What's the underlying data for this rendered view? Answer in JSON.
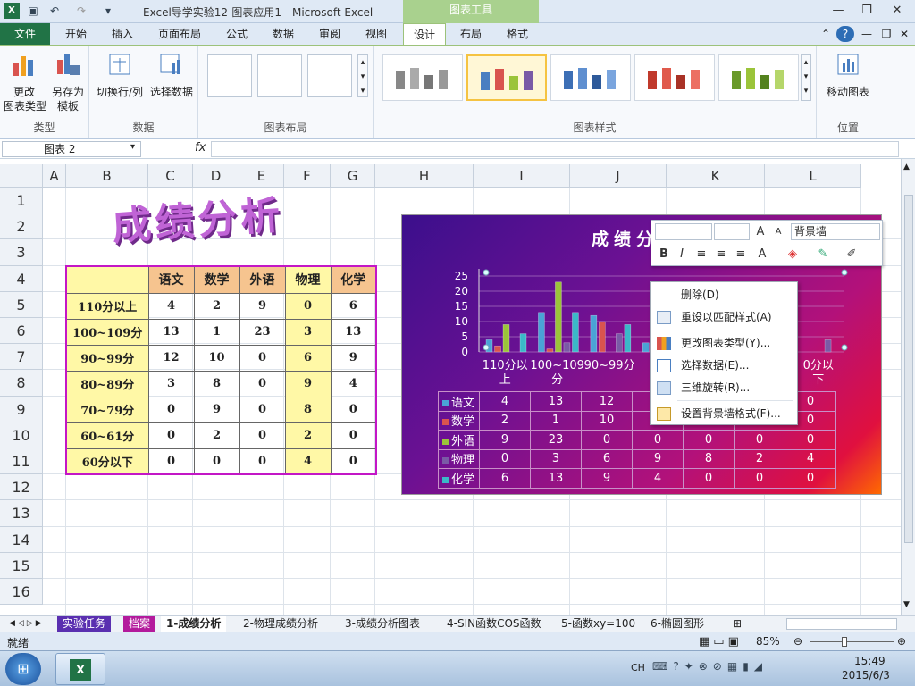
{
  "window": {
    "title": "Excel导学实验12-图表应用1 - Microsoft Excel",
    "context_tools": "图表工具"
  },
  "tabs": [
    "文件",
    "开始",
    "插入",
    "页面布局",
    "公式",
    "数据",
    "审阅",
    "视图",
    "设计",
    "布局",
    "格式"
  ],
  "ribbon": {
    "change_type": "更改\n图表类型",
    "save_template": "另存为\n模板",
    "switch_rowcol": "切换行/列",
    "select_data": "选择数据",
    "move_chart": "移动图表",
    "groups": {
      "type": "类型",
      "data": "数据",
      "layout": "图表布局",
      "styles": "图表样式",
      "location": "位置"
    }
  },
  "formula_bar": {
    "name_box": "图表 2",
    "fx": "fx"
  },
  "columns": [
    "A",
    "B",
    "C",
    "D",
    "E",
    "F",
    "G",
    "H",
    "I",
    "J",
    "K",
    "L"
  ],
  "rows": [
    "1",
    "2",
    "3",
    "4",
    "5",
    "6",
    "7",
    "8",
    "9",
    "10",
    "11",
    "12",
    "13",
    "14",
    "15",
    "16"
  ],
  "sheet_title": "成绩分析",
  "table": {
    "headers": [
      "语文",
      "数学",
      "外语",
      "物理",
      "化学"
    ],
    "rows": [
      {
        "label": "110分以上",
        "values": [
          "4",
          "2",
          "9",
          "0",
          "6"
        ]
      },
      {
        "label": "100~109分",
        "values": [
          "13",
          "1",
          "23",
          "3",
          "13"
        ]
      },
      {
        "label": "90~99分",
        "values": [
          "12",
          "10",
          "0",
          "6",
          "9"
        ]
      },
      {
        "label": "80~89分",
        "values": [
          "3",
          "8",
          "0",
          "9",
          "4"
        ]
      },
      {
        "label": "70~79分",
        "values": [
          "0",
          "9",
          "0",
          "8",
          "0"
        ]
      },
      {
        "label": "60~61分",
        "values": [
          "0",
          "2",
          "0",
          "2",
          "0"
        ]
      },
      {
        "label": "60分以下",
        "values": [
          "0",
          "0",
          "0",
          "4",
          "0"
        ]
      }
    ]
  },
  "chart_data": {
    "type": "bar",
    "title": "成绩分",
    "categories": [
      "110分以上",
      "100~109分",
      "90~99分",
      "80~89分",
      "70~79分",
      "60~61分",
      "60分以下"
    ],
    "category_labels_visible": [
      "110分以\n上",
      "100~109\n分",
      "90~99分",
      "80",
      "",
      "",
      "0分以\n下"
    ],
    "ylim": [
      0,
      25
    ],
    "yticks": [
      "25",
      "20",
      "15",
      "10",
      "5",
      "0"
    ],
    "series": [
      {
        "name": "语文",
        "color": "#4aa3d6",
        "values": [
          4,
          13,
          12,
          3,
          0,
          0,
          0
        ]
      },
      {
        "name": "数学",
        "color": "#d9544f",
        "values": [
          2,
          1,
          10,
          8,
          9,
          2,
          0
        ]
      },
      {
        "name": "外语",
        "color": "#9bc43a",
        "values": [
          9,
          23,
          0,
          0,
          0,
          0,
          0
        ]
      },
      {
        "name": "物理",
        "color": "#7a5aa6",
        "values": [
          0,
          3,
          6,
          9,
          8,
          2,
          4
        ]
      },
      {
        "name": "化学",
        "color": "#3bb8c8",
        "values": [
          6,
          13,
          9,
          4,
          0,
          0,
          0
        ]
      }
    ],
    "table_visible": [
      [
        "4",
        "13",
        "12",
        "",
        "",
        "",
        "0"
      ],
      [
        "2",
        "1",
        "10",
        "",
        "",
        "",
        "0"
      ],
      [
        "9",
        "23",
        "0",
        "0",
        "0",
        "0",
        "0"
      ],
      [
        "0",
        "3",
        "6",
        "9",
        "8",
        "2",
        "4"
      ],
      [
        "6",
        "13",
        "9",
        "4",
        "0",
        "0",
        "0"
      ]
    ]
  },
  "mini_toolbar": {
    "font_box": "",
    "size_box": "",
    "element": "背景墙"
  },
  "context_menu": [
    {
      "label": "删除(D)"
    },
    {
      "label": "重设以匹配样式(A)"
    },
    {
      "label": "更改图表类型(Y)..."
    },
    {
      "label": "选择数据(E)..."
    },
    {
      "label": "三维旋转(R)..."
    },
    {
      "label": "设置背景墙格式(F)..."
    }
  ],
  "sheet_tabs": [
    "实验任务",
    "档案",
    "1-成绩分析",
    "2-物理成绩分析",
    "3-成绩分析图表",
    "4-SIN函数COS函数",
    "5-函数xy=100",
    "6-椭圆图形"
  ],
  "status": {
    "ready": "就绪",
    "zoom": "85%"
  },
  "taskbar": {
    "lang": "CH",
    "time": "15:49",
    "date": "2015/6/3"
  }
}
